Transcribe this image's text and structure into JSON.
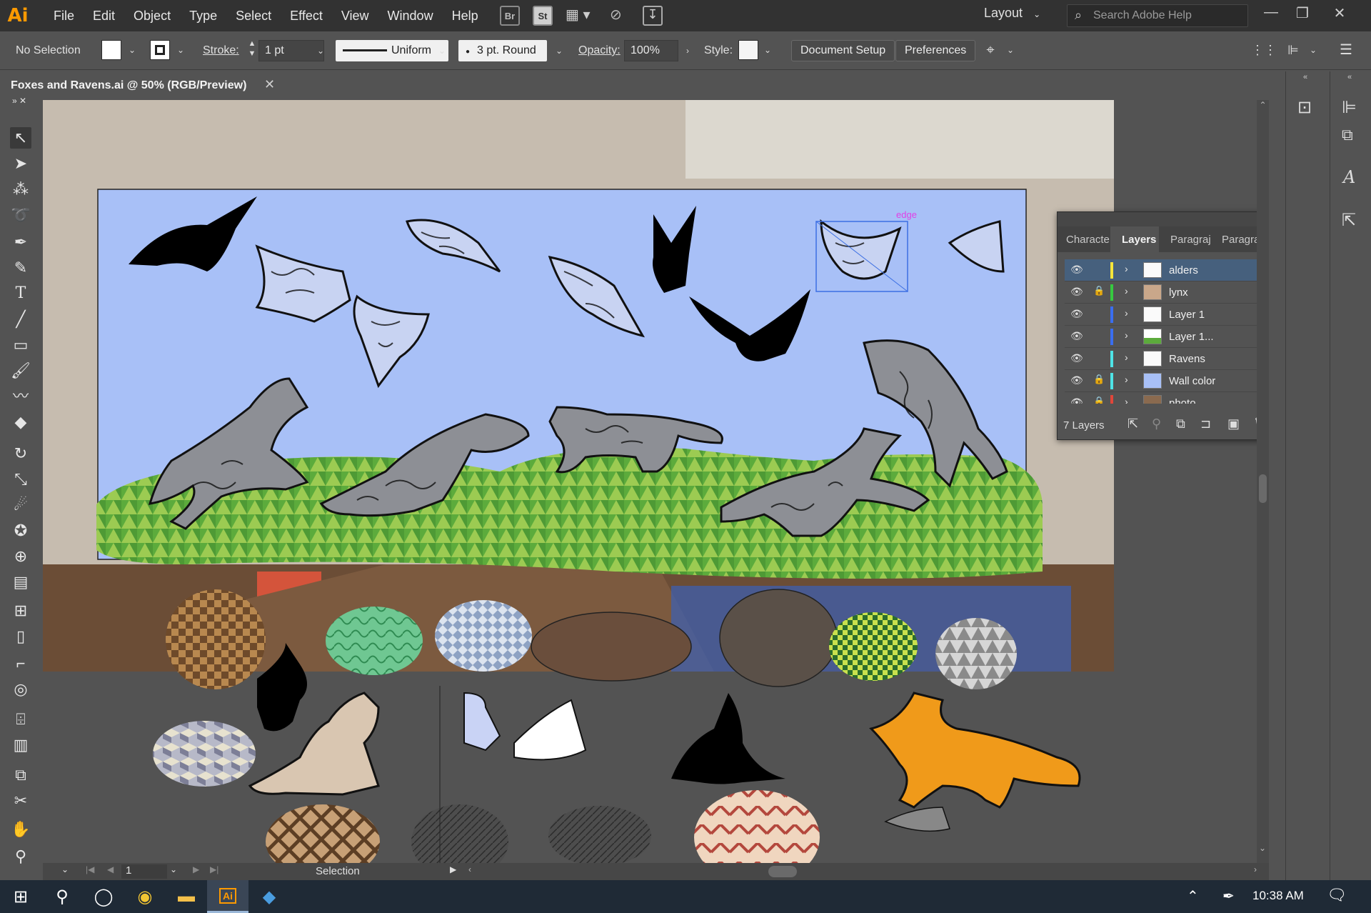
{
  "app": {
    "logo": "Ai"
  },
  "menu": [
    "File",
    "Edit",
    "Object",
    "Type",
    "Select",
    "Effect",
    "View",
    "Window",
    "Help"
  ],
  "appbar": {
    "bridge": "Br",
    "stock": "St",
    "workspace": "Layout",
    "search_placeholder": "Search Adobe Help"
  },
  "control": {
    "selection": "No Selection",
    "stroke_label": "Stroke:",
    "stroke_value": "1 pt",
    "profile": "Uniform",
    "brush": "3 pt. Round",
    "opacity_label": "Opacity:",
    "opacity_value": "100%",
    "style_label": "Style:",
    "document_setup": "Document Setup",
    "preferences": "Preferences"
  },
  "document": {
    "tab_title": "Foxes and Ravens.ai @ 50% (RGB/Preview)",
    "selection_label": "edge"
  },
  "layers_panel": {
    "tabs": [
      "Characte",
      "Layers",
      "Paragraj",
      "Paragraj"
    ],
    "active_tab": "Layers",
    "layers": [
      {
        "name": "alders",
        "color": "#f5e53a",
        "locked": false,
        "selected": true
      },
      {
        "name": "lynx",
        "color": "#36c940",
        "locked": true,
        "selected": false
      },
      {
        "name": "Layer 1",
        "color": "#3a6ef0",
        "locked": false,
        "selected": false
      },
      {
        "name": "Layer 1...",
        "color": "#3a6ef0",
        "locked": false,
        "selected": false
      },
      {
        "name": "Ravens",
        "color": "#4ee3e6",
        "locked": false,
        "selected": false
      },
      {
        "name": "Wall color",
        "color": "#4ee3e6",
        "locked": true,
        "selected": false
      },
      {
        "name": "photo",
        "color": "#e0463a",
        "locked": true,
        "selected": false
      }
    ],
    "count_label": "7 Layers"
  },
  "status": {
    "page": "1",
    "tool": "Selection"
  },
  "taskbar": {
    "time": "10:38 AM"
  }
}
